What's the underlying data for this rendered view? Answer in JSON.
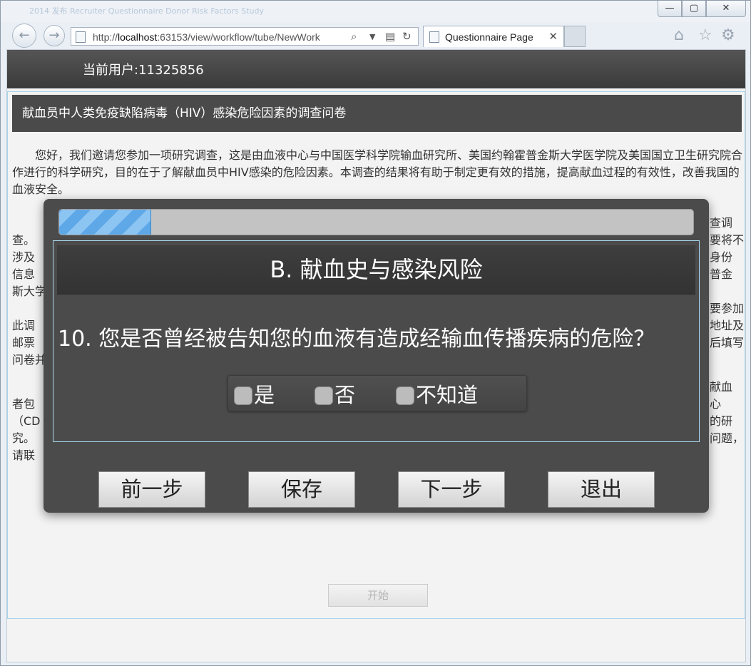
{
  "browser": {
    "window_title": "2014 发布 Recruiter Questionnaire Donor Risk Factors Study",
    "url_prefix": "http://",
    "url_host": "localhost",
    "url_rest": ":63153/view/workflow/tube/NewWork",
    "tab_title": "Questionnaire Page",
    "min_glyph": "—",
    "max_glyph": "▢",
    "close_glyph": "✕"
  },
  "header": {
    "current_user_label": "当前用户:",
    "current_user_id": "11325856"
  },
  "form": {
    "title": "献血员中人类免疫缺陷病毒（HIV）感染危险因素的调查问卷",
    "intro": "您好，我们邀请您参加一项研究调查，这是由血液中心与中国医学科学院输血研究所、美国约翰霍普金斯大学医学院及美国国立卫生研究院合作进行的科学研究，目的在于了解献血员中HIV感染的危险因素。本调查的结果将有助于制定更有效的措施，提高献血过程的有效性，改善我国的血液安全。",
    "peek_right": [
      "查调",
      "要将不",
      "身份",
      "普金"
    ],
    "peek_left": [
      "查。",
      "涉及",
      "信息",
      "斯大学"
    ],
    "peek_right2": [
      "要参加",
      "地址及",
      "后填写"
    ],
    "peek_left2": [
      "此调",
      "邮票",
      "问卷并"
    ],
    "peek_right3": [
      "献血",
      "心",
      "的研",
      "问题，"
    ],
    "peek_left3": [
      "者包",
      "（CD",
      "究。",
      "请联"
    ],
    "start_button": "开始"
  },
  "modal": {
    "progress_percent": 14.5,
    "section_title": "B. 献血史与感染风险",
    "question_number": "10.",
    "question_text": "您是否曾经被告知您的血液有造成经输血传播疾病的危险？",
    "options": [
      "是",
      "否",
      "不知道"
    ],
    "buttons": {
      "prev": "前一步",
      "save": "保存",
      "next": "下一步",
      "exit": "退出"
    }
  }
}
